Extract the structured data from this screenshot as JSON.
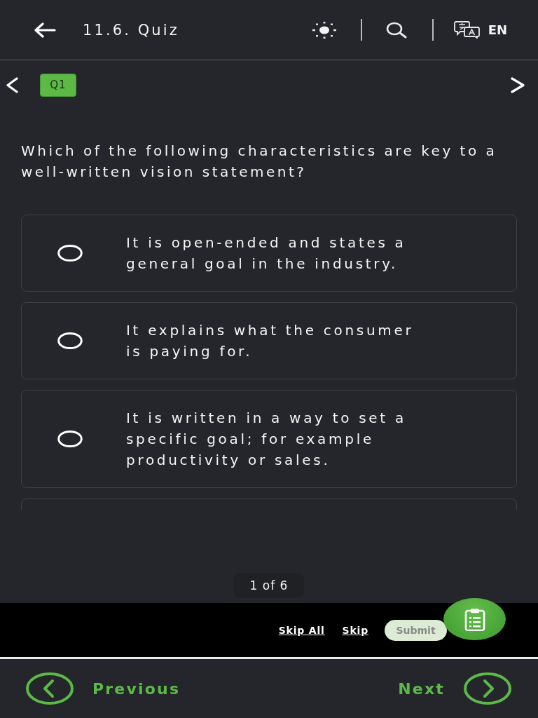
{
  "header": {
    "title": "11.6. Quiz",
    "language": "EN"
  },
  "question_nav": {
    "badge": "Q1"
  },
  "question": {
    "text": "Which of the following characteristics are key to a well-written vision statement?",
    "options": [
      {
        "text": "It is open-ended and states a general goal in the industry.",
        "selected": false
      },
      {
        "text": "It explains what the consumer is paying for.",
        "selected": false
      },
      {
        "text": "It is written in a way to set a specific goal; for example productivity or sales.",
        "selected": false
      }
    ],
    "more_options_below": true
  },
  "progress": "1 of 6",
  "action_bar": {
    "skip_all": "Skip All",
    "skip": "Skip",
    "submit": {
      "label": "Submit",
      "disabled": true
    }
  },
  "footer": {
    "previous": "Previous",
    "next": "Next"
  }
}
